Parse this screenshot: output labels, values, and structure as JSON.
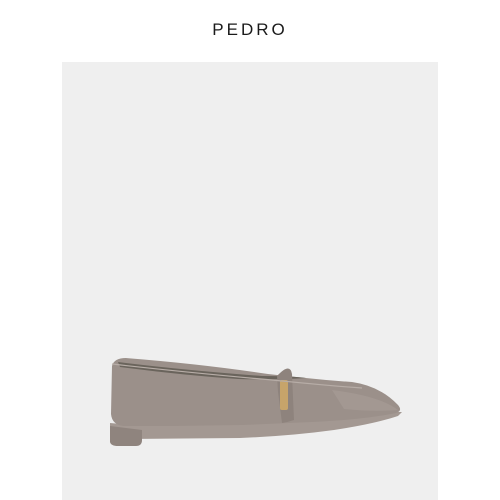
{
  "header": {
    "brand_logo": "PEDRO"
  },
  "product": {
    "image_icon": "pointed-toe-mary-jane-flat-shoe-icon",
    "panel_color": "#efefef",
    "shoe_color": "#9a8f88"
  }
}
